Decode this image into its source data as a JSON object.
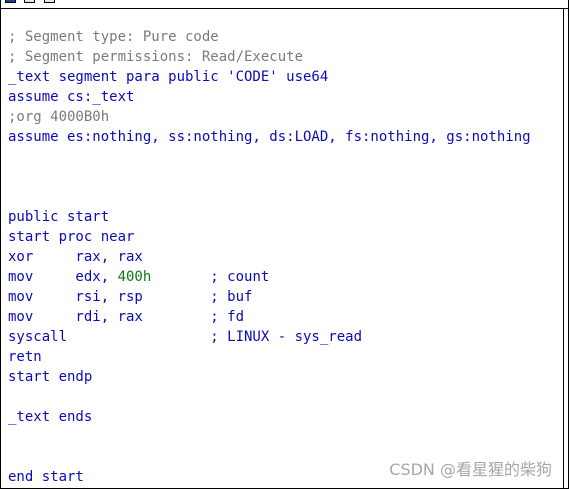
{
  "code_lines": [
    {
      "parts": [
        {
          "text": "; Segment type: Pure code",
          "cls": "comment"
        }
      ]
    },
    {
      "parts": [
        {
          "text": "; Segment permissions: Read/Execute",
          "cls": "comment"
        }
      ]
    },
    {
      "parts": [
        {
          "text": "_text segment para public 'CODE' use64",
          "cls": "blue"
        }
      ]
    },
    {
      "parts": [
        {
          "text": "assume cs:_text",
          "cls": "blue"
        }
      ]
    },
    {
      "parts": [
        {
          "text": ";org 4000B0h",
          "cls": "comment"
        }
      ]
    },
    {
      "parts": [
        {
          "text": "assume es:nothing, ss:nothing, ds:LOAD, fs:nothing, gs:nothing",
          "cls": "blue"
        }
      ]
    },
    {
      "parts": [
        {
          "text": "",
          "cls": "blue"
        }
      ]
    },
    {
      "parts": [
        {
          "text": "",
          "cls": "blue"
        }
      ]
    },
    {
      "parts": [
        {
          "text": "",
          "cls": "blue"
        }
      ]
    },
    {
      "parts": [
        {
          "text": "public start",
          "cls": "blue"
        }
      ]
    },
    {
      "parts": [
        {
          "text": "start proc near",
          "cls": "blue"
        }
      ]
    },
    {
      "parts": [
        {
          "text": "xor     rax, rax",
          "cls": "blue"
        }
      ]
    },
    {
      "parts": [
        {
          "text": "mov     edx, ",
          "cls": "blue"
        },
        {
          "text": "400h",
          "cls": "num"
        },
        {
          "text": "       ; count",
          "cls": "blue"
        }
      ]
    },
    {
      "parts": [
        {
          "text": "mov     rsi, rsp        ; buf",
          "cls": "blue"
        }
      ]
    },
    {
      "parts": [
        {
          "text": "mov     rdi, rax        ; fd",
          "cls": "blue"
        }
      ]
    },
    {
      "parts": [
        {
          "text": "syscall                 ; LINUX - sys_read",
          "cls": "blue"
        }
      ]
    },
    {
      "parts": [
        {
          "text": "retn",
          "cls": "blue"
        }
      ]
    },
    {
      "parts": [
        {
          "text": "start endp",
          "cls": "blue"
        }
      ]
    },
    {
      "parts": [
        {
          "text": "",
          "cls": "blue"
        }
      ]
    },
    {
      "parts": [
        {
          "text": "_text ends",
          "cls": "blue"
        }
      ]
    },
    {
      "parts": [
        {
          "text": "",
          "cls": "blue"
        }
      ]
    },
    {
      "parts": [
        {
          "text": "",
          "cls": "blue"
        }
      ]
    },
    {
      "parts": [
        {
          "text": "end start",
          "cls": "blue"
        }
      ]
    }
  ],
  "watermark": "CSDN @看星猩的柴狗"
}
